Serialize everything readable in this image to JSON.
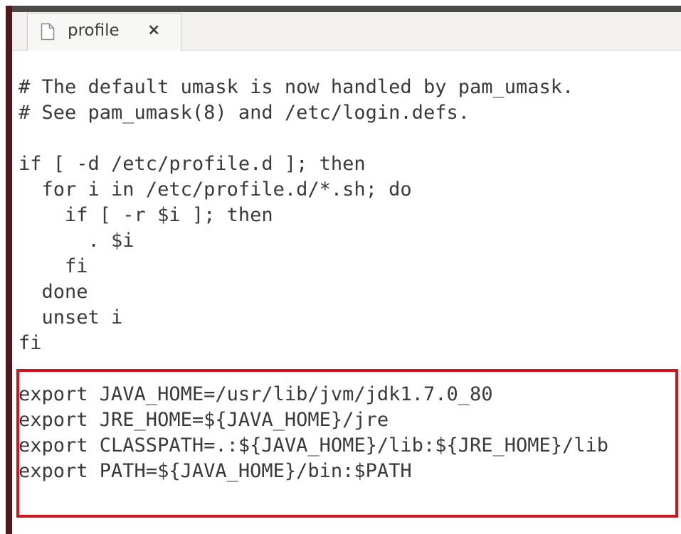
{
  "tab": {
    "title": "profile",
    "close_symbol": "×",
    "icon": "document-icon"
  },
  "editor": {
    "lines": [
      "# The default umask is now handled by pam_umask.",
      "# See pam_umask(8) and /etc/login.defs.",
      "",
      "if [ -d /etc/profile.d ]; then",
      "  for i in /etc/profile.d/*.sh; do",
      "    if [ -r $i ]; then",
      "      . $i",
      "    fi",
      "  done",
      "  unset i",
      "fi",
      "",
      "export JAVA_HOME=/usr/lib/jvm/jdk1.7.0_80",
      "export JRE_HOME=${JAVA_HOME}/jre",
      "export CLASSPATH=.:${JAVA_HOME}/lib:${JRE_HOME}/lib",
      "export PATH=${JAVA_HOME}/bin:$PATH"
    ]
  },
  "colors": {
    "highlight_border": "#d3151b",
    "text": "#3a3a3a"
  }
}
